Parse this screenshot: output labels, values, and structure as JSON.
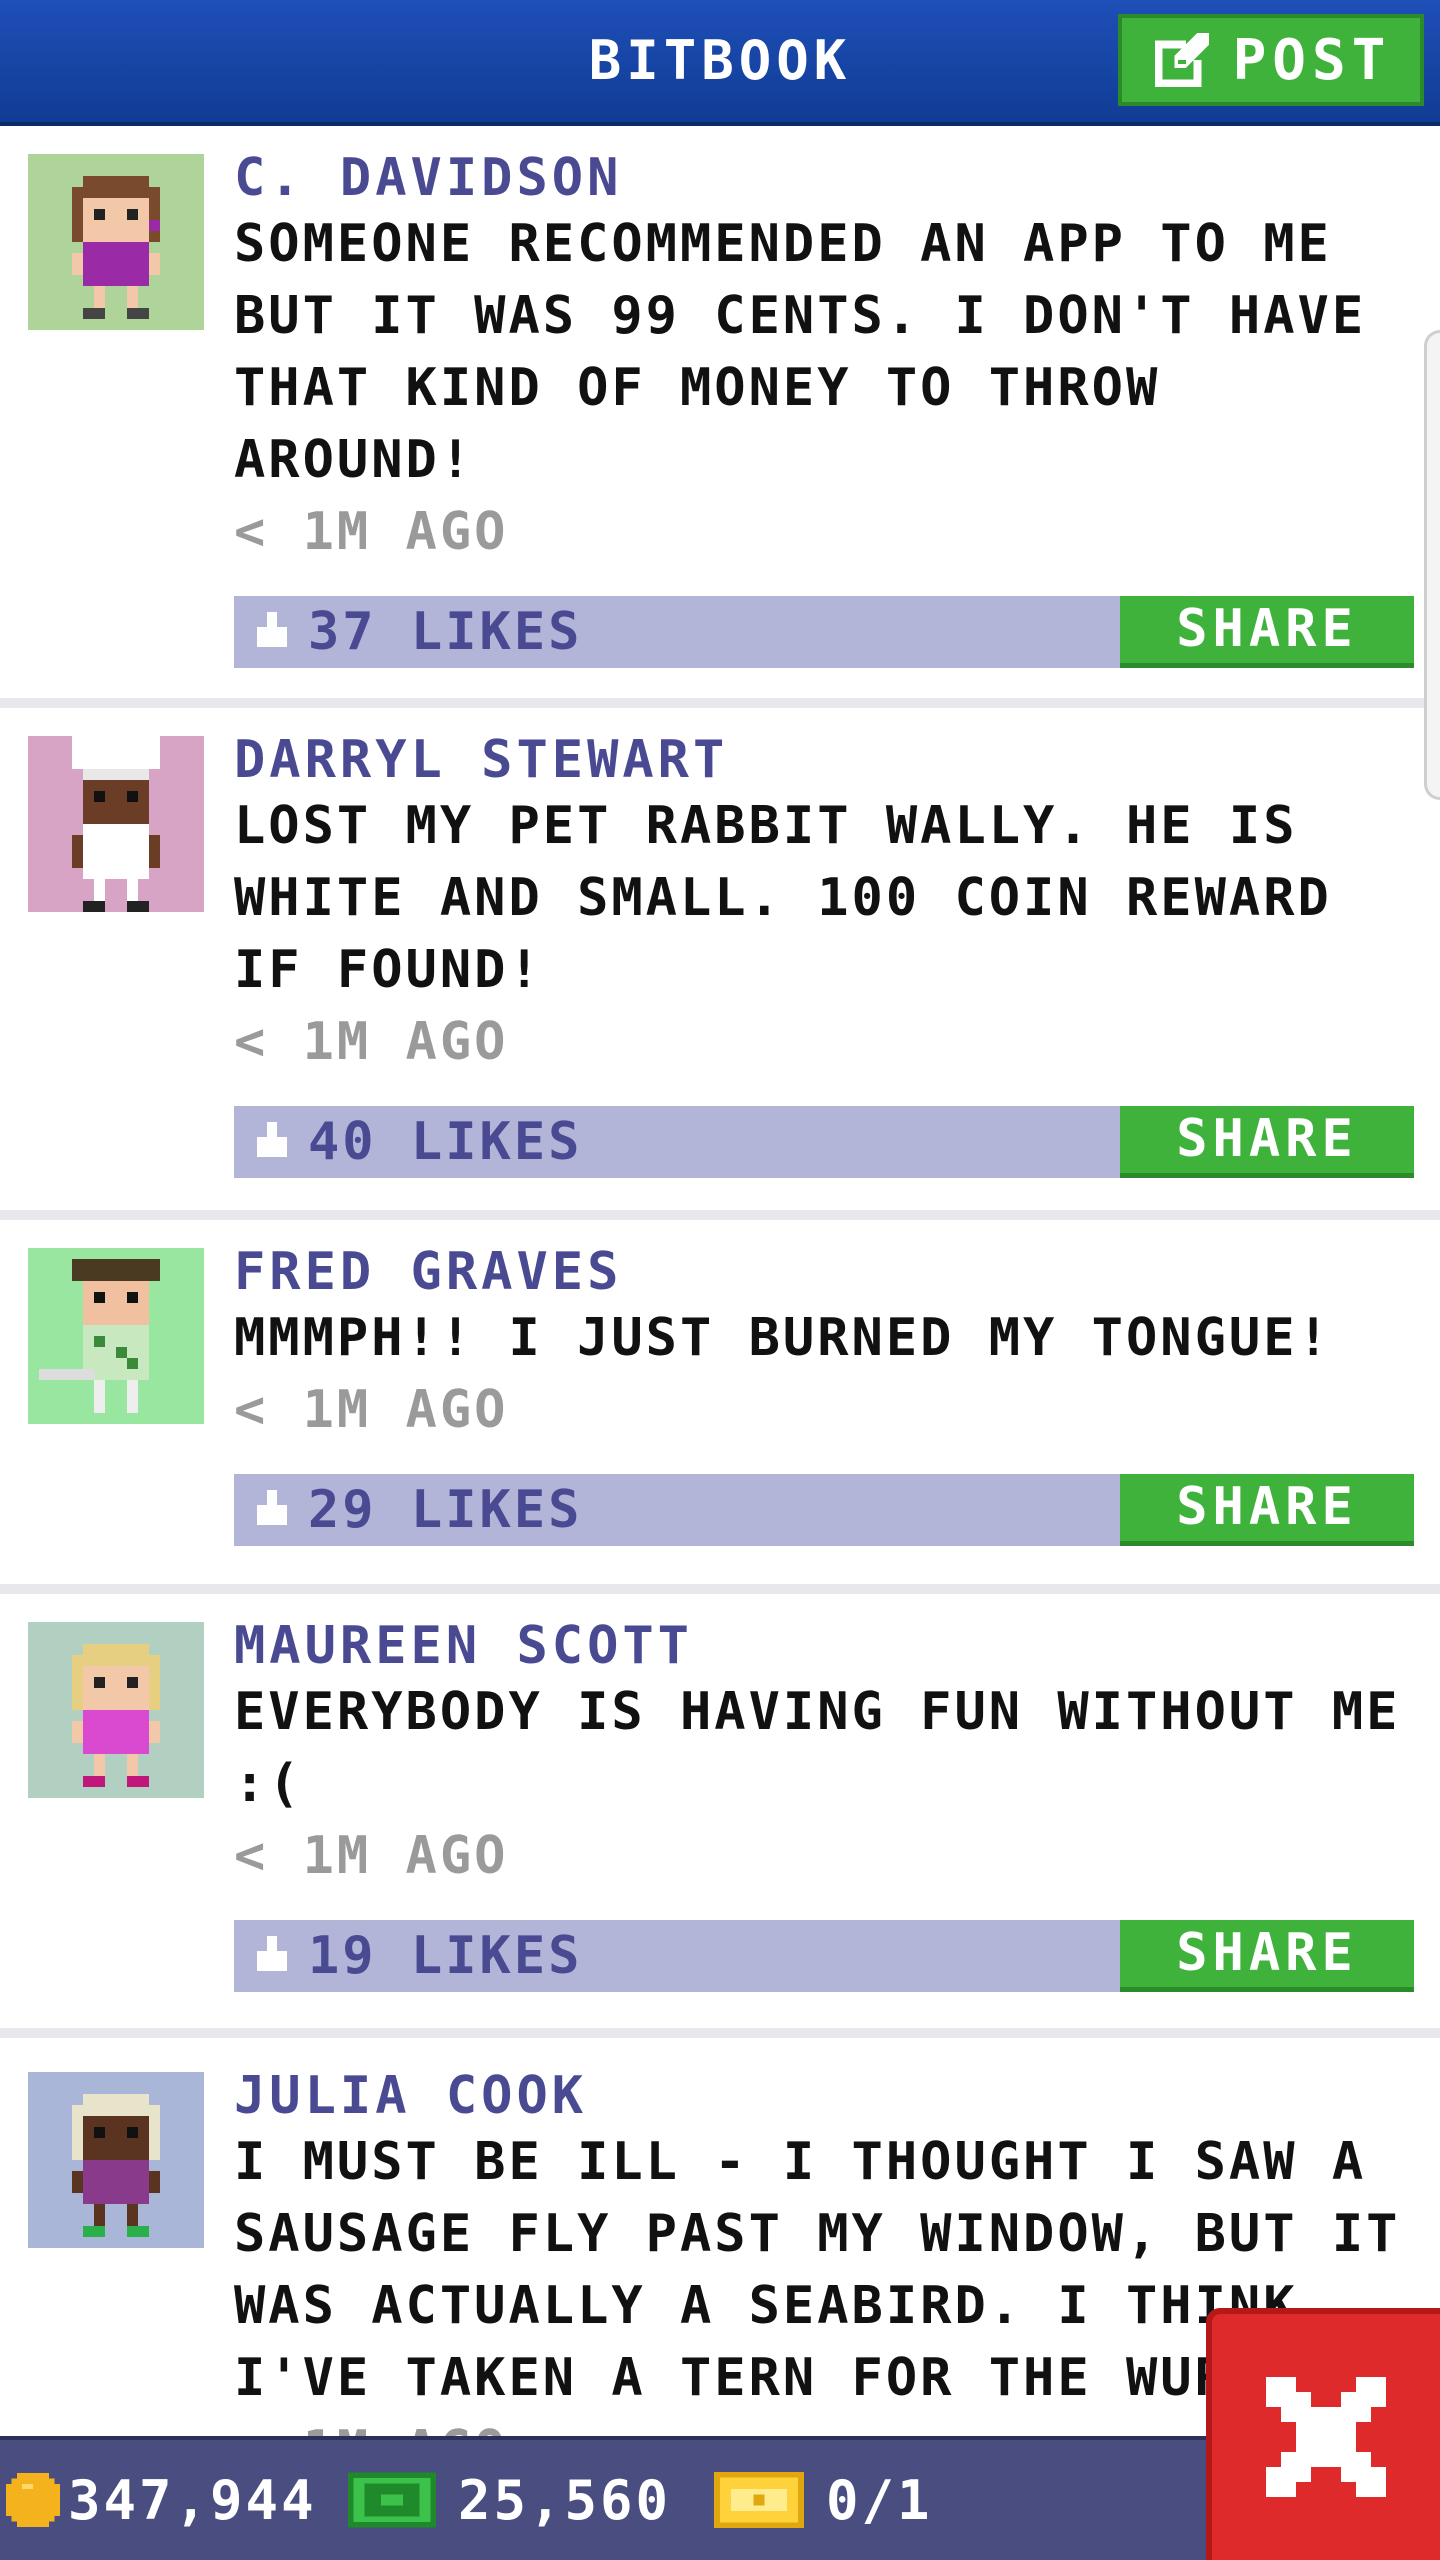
{
  "app": {
    "title": "BITBOOK",
    "post_label": "POST"
  },
  "posts": [
    {
      "author": "C. DAVIDSON",
      "message": "SOMEONE RECOMMENDED AN APP TO ME BUT IT WAS 99 CENTS. I DON'T HAVE THAT KIND OF MONEY TO THROW AROUND!",
      "time": "< 1M AGO",
      "likes": "37 LIKES",
      "share_label": "SHARE",
      "avatar_bg": "#aed49a",
      "avatar_name": "woman-brown-hair-avatar"
    },
    {
      "author": "DARRYL STEWART",
      "message": "LOST MY PET RABBIT WALLY. HE IS WHITE AND SMALL. 100 COIN REWARD IF FOUND!",
      "time": "< 1M AGO",
      "likes": "40 LIKES",
      "share_label": "SHARE",
      "avatar_bg": "#d7a4c6",
      "avatar_name": "chef-avatar"
    },
    {
      "author": "FRED GRAVES",
      "message": "MMMPH!! I JUST BURNED MY TONGUE!",
      "time": "< 1M AGO",
      "likes": "29 LIKES",
      "share_label": "SHARE",
      "avatar_bg": "#98e6a0",
      "avatar_name": "golfer-avatar"
    },
    {
      "author": "MAUREEN SCOTT",
      "message": "EVERYBODY IS HAVING FUN WITHOUT ME :(",
      "time": "< 1M AGO",
      "likes": "19 LIKES",
      "share_label": "SHARE",
      "avatar_bg": "#b1d0c2",
      "avatar_name": "woman-blonde-avatar"
    },
    {
      "author": "JULIA COOK",
      "message": "I MUST BE ILL - I THOUGHT I SAW A SAUSAGE FLY PAST MY WINDOW, BUT IT WAS ACTUALLY A SEABIRD. I THINK I'VE TAKEN A TERN FOR THE WURST.",
      "time": "< 1M AGO",
      "likes": "",
      "share_label": "",
      "avatar_bg": "#a9b6d8",
      "avatar_name": "woman-white-hair-avatar"
    }
  ],
  "status": {
    "coins": "347,944",
    "bux": "25,560",
    "tickets": "0/1"
  },
  "colors": {
    "header_blue": "#1a48ac",
    "share_green": "#3fb23c",
    "likes_bar": "#b3b5d8",
    "author_purple": "#4a4a92",
    "close_red": "#de2a2a"
  }
}
